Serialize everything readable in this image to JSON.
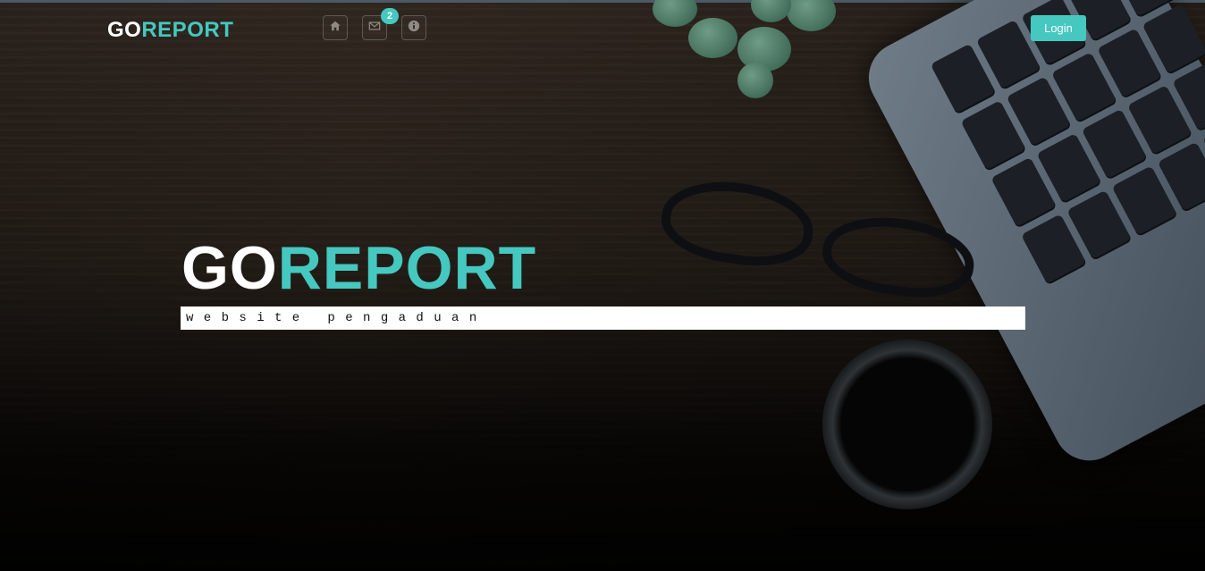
{
  "brand": {
    "part1": "GO",
    "part2": "REPORT"
  },
  "nav": {
    "icons": [
      {
        "name": "home-icon"
      },
      {
        "name": "envelope-icon",
        "badge": "2"
      },
      {
        "name": "info-icon"
      }
    ],
    "login_label": "Login"
  },
  "hero": {
    "title_part1": "GO",
    "title_part2": "REPORT",
    "subtitle": "website pengaduan"
  },
  "colors": {
    "accent": "#45c8c0",
    "text_light": "#ffffff",
    "background": "#1b1612"
  }
}
